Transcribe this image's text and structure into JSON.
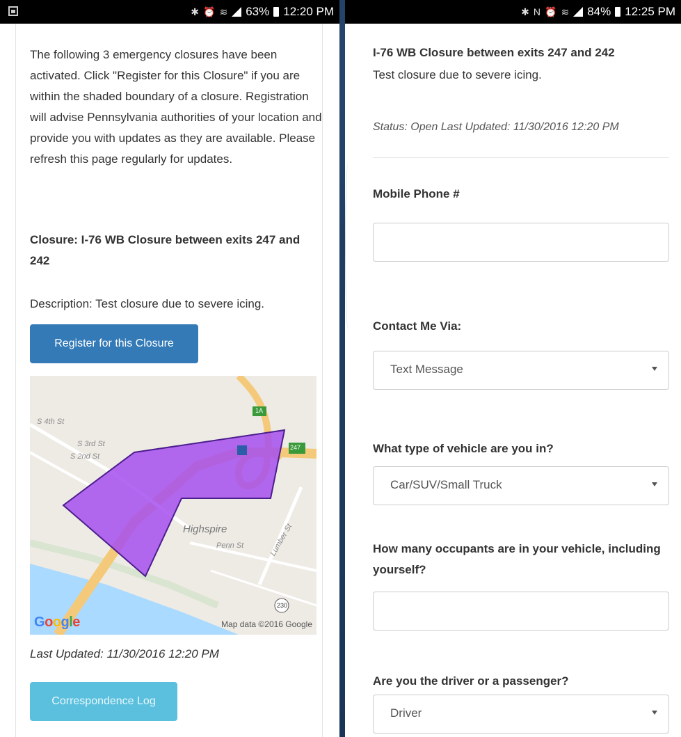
{
  "left_phone": {
    "status_bar": {
      "battery": "63%",
      "time": "12:20 PM"
    },
    "intro_text": "The following 3 emergency closures have been activated. Click \"Register for this Closure\" if you are within the shaded boundary of a closure. Registration will advise Pennsylvania authorities of your location and provide you with updates as they are available. Please refresh this page regularly for updates.",
    "closure_title": "Closure: I-76 WB Closure between exits 247 and 242",
    "description": "Description: Test closure due to severe icing.",
    "register_button": "Register for this Closure",
    "map": {
      "labels": {
        "s4th": "S 4th St",
        "s3rd": "S 3rd St",
        "s2nd": "S 2nd St",
        "highspire": "Highspire",
        "penn": "Penn St",
        "lumber": "Lumber St",
        "route_1a": "1A",
        "route_247": "247",
        "route_230": "230"
      },
      "google_logo": "Google",
      "attribution": "Map data ©2016 Google",
      "colors": {
        "polygon_fill": "#a64ff0",
        "polygon_stroke": "#4b1e8c",
        "highway": "#f5c97a",
        "water": "#aadaff"
      }
    },
    "last_updated": "Last Updated: 11/30/2016 12:20 PM",
    "correspondence_button": "Correspondence Log"
  },
  "right_phone": {
    "status_bar": {
      "battery": "84%",
      "time": "12:25 PM"
    },
    "closure_title": "I-76 WB Closure between exits 247 and 242",
    "description": "Test closure due to severe icing.",
    "status": "Status: Open Last Updated: 11/30/2016 12:20 PM",
    "form": {
      "mobile_label": "Mobile Phone #",
      "mobile_value": "",
      "contact_label": "Contact Me Via:",
      "contact_value": "Text Message",
      "vehicle_label": "What type of vehicle are you in?",
      "vehicle_value": "Car/SUV/Small Truck",
      "occupants_label": "How many occupants are in your vehicle, including yourself?",
      "occupants_value": "",
      "driver_label": "Are you the driver or a passenger?",
      "driver_value": "Driver"
    }
  },
  "colors": {
    "primary_button": "#337ab7",
    "info_button": "#5bc0de"
  }
}
